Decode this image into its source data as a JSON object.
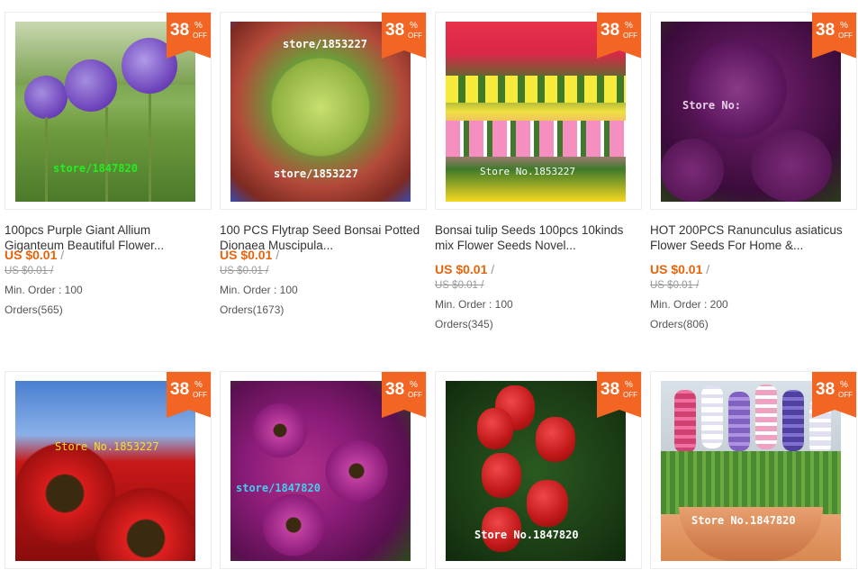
{
  "discount": {
    "value": "38",
    "percent": "%",
    "off": "OFF"
  },
  "products": [
    {
      "title": "100pcs Purple Giant Allium Giganteum Beautiful Flower...",
      "price": "US $0.01",
      "slash": "/",
      "old_price": "US $0.01 /",
      "min_order": "Min. Order : 100",
      "orders": "Orders(565)",
      "watermark": "store/1847820"
    },
    {
      "title": "100 PCS Flytrap Seed Bonsai Potted Dionaea Muscipula...",
      "price": "US $0.01",
      "slash": "/",
      "old_price": "US $0.01 /",
      "min_order": "Min. Order : 100",
      "orders": "Orders(1673)",
      "watermark": "store/1853227",
      "watermark2": "store/1853227"
    },
    {
      "title": "Bonsai tulip Seeds 100pcs 10kinds mix Flower Seeds Novel...",
      "price": "US $0.01",
      "slash": "/",
      "old_price": "US $0.01 /",
      "min_order": "Min. Order : 100",
      "orders": "Orders(345)",
      "watermark": "Store No.1853227"
    },
    {
      "title": "HOT 200PCS Ranunculus asiaticus Flower Seeds For Home &...",
      "price": "US $0.01",
      "slash": "/",
      "old_price": "US $0.01 /",
      "min_order": "Min. Order : 200",
      "orders": "Orders(806)",
      "watermark": "Store No:"
    },
    {
      "watermark": "Store No.1853227"
    },
    {
      "watermark": "store/1847820"
    },
    {
      "watermark": "Store No.1847820"
    },
    {
      "watermark": "Store No.1847820"
    }
  ],
  "colors": {
    "accent": "#f26522",
    "price": "#e8630a"
  }
}
